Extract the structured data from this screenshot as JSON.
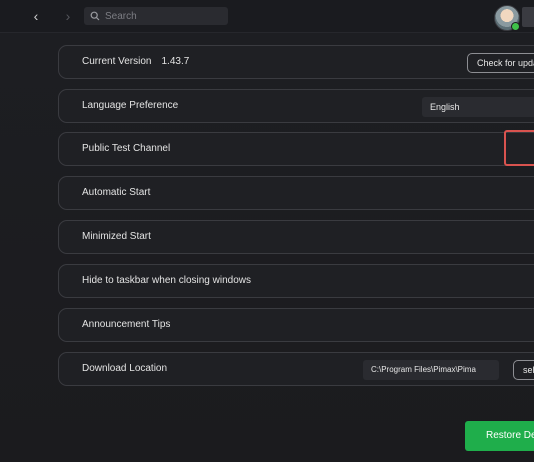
{
  "topbar": {
    "back_glyph": "‹",
    "forward_glyph": "›",
    "search_placeholder": "Search"
  },
  "settings": {
    "current_version": {
      "label": "Current Version",
      "value": "1.43.7",
      "button": "Check for upda"
    },
    "language": {
      "label": "Language Preference",
      "selected": "English"
    },
    "public_test": {
      "label": "Public Test Channel"
    },
    "auto_start": {
      "label": "Automatic Start"
    },
    "minimized_start": {
      "label": "Minimized Start"
    },
    "hide_taskbar": {
      "label": "Hide to taskbar when closing windows"
    },
    "announcement": {
      "label": "Announcement Tips"
    },
    "download": {
      "label": "Download Location",
      "path": "C:\\Program Files\\Pimax\\Pima",
      "button": "sel"
    }
  },
  "restore_button": "Restore De",
  "colors": {
    "accent_green": "#1fae4b",
    "highlight_red": "#d9534f",
    "online_dot": "#3fc24a"
  },
  "icons": [
    "chevron-left-icon",
    "chevron-right-icon",
    "search-icon"
  ]
}
